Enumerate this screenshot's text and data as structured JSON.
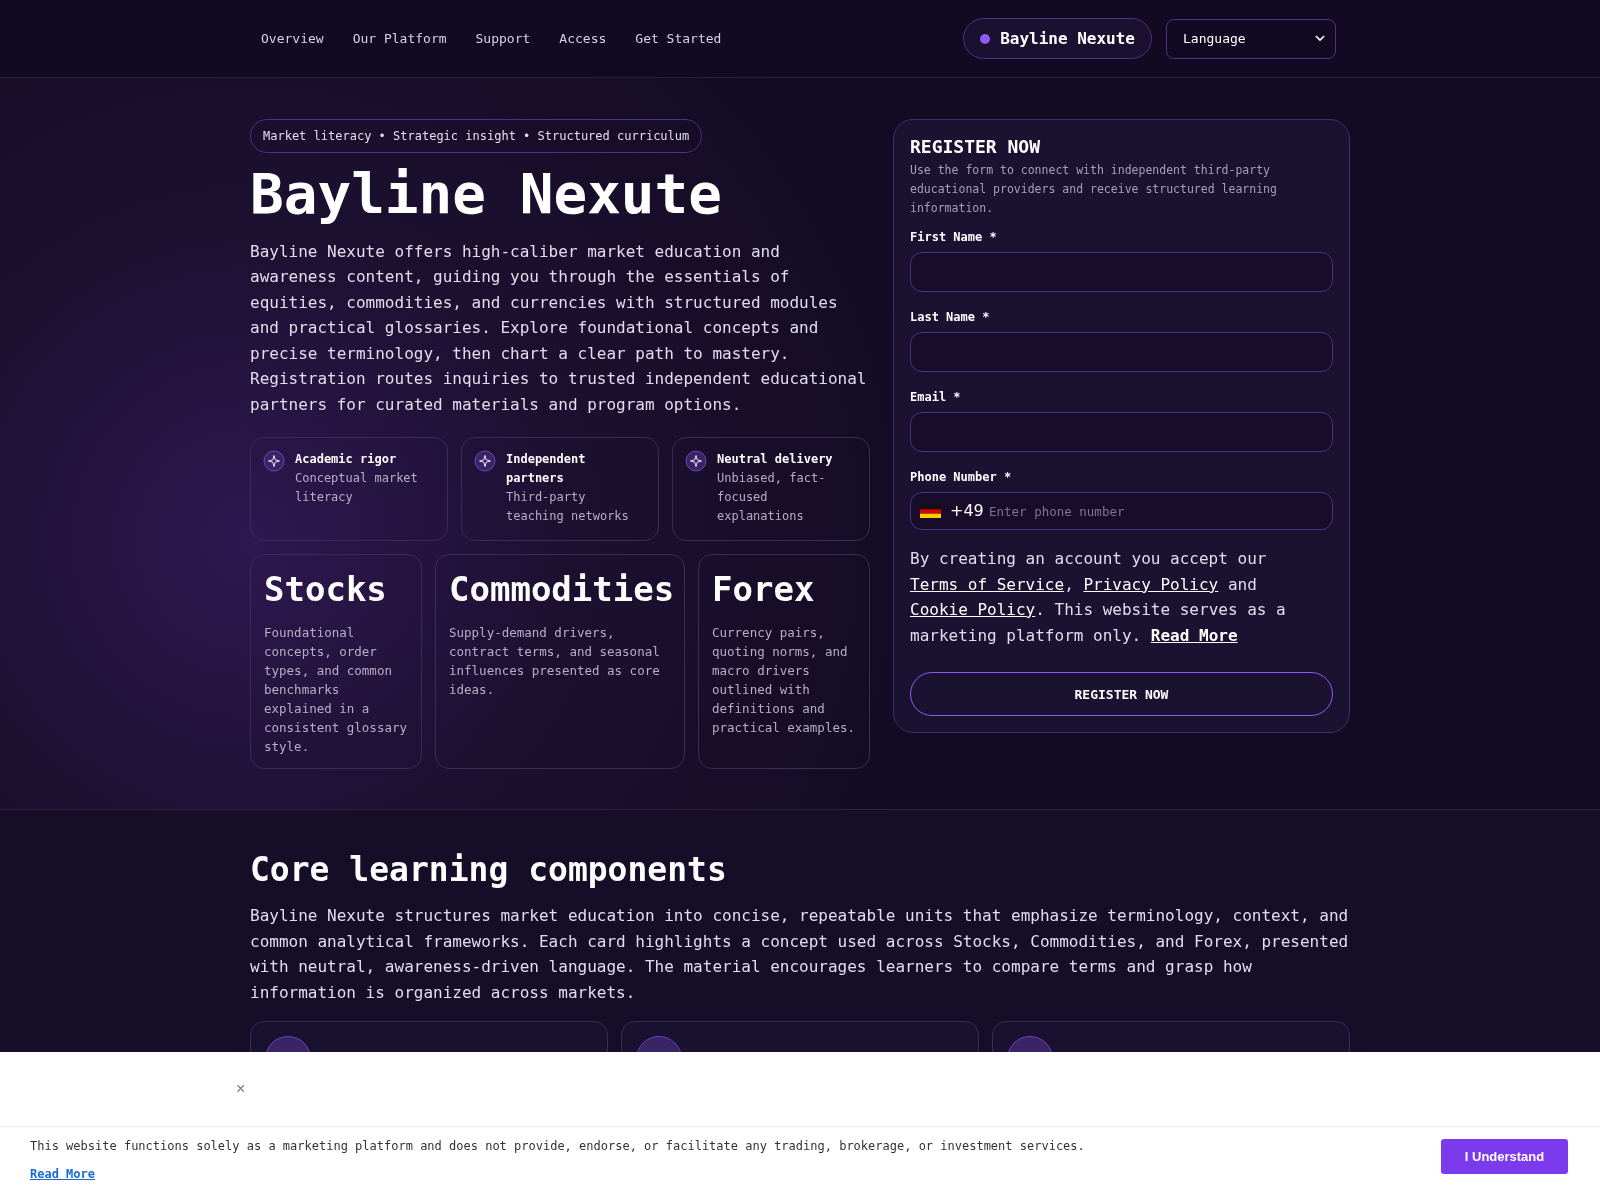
{
  "nav": {
    "links": [
      {
        "label": "Overview"
      },
      {
        "label": "Our Platform"
      },
      {
        "label": "Support"
      },
      {
        "label": "Access"
      },
      {
        "label": "Get Started"
      }
    ],
    "brand": "Bayline Nexute",
    "language_select": "Language"
  },
  "hero": {
    "tagline": "Market literacy • Strategic insight • Structured curriculum",
    "title": "Bayline Nexute",
    "description": "Bayline Nexute offers high-caliber market education and awareness content, guiding you through the essentials of equities, commodities, and currencies with structured modules and practical glossaries. Explore foundational concepts and precise terminology, then chart a clear path to mastery. Registration routes inquiries to trusted independent educational partners for curated materials and program options.",
    "features": [
      {
        "title": "Academic rigor",
        "text": "Conceptual market literacy"
      },
      {
        "title": "Independent partners",
        "text": "Third-party teaching networks"
      },
      {
        "title": "Neutral delivery",
        "text": "Unbiased, fact-focused explanations"
      }
    ],
    "markets": [
      {
        "title": "Stocks",
        "text": "Foundational concepts, order types, and common benchmarks explained in a consistent glossary style."
      },
      {
        "title": "Commodities",
        "text": "Supply-demand drivers, contract terms, and seasonal influences presented as core ideas."
      },
      {
        "title": "Forex",
        "text": "Currency pairs, quoting norms, and macro drivers outlined with definitions and practical examples."
      }
    ]
  },
  "register_form": {
    "title": "REGISTER NOW",
    "intro": "Use the form to connect with independent third-party educational providers and receive structured learning information.",
    "fields": [
      {
        "label": "First Name *",
        "kind": "text"
      },
      {
        "label": "Last Name *",
        "kind": "text"
      },
      {
        "label": "Email *",
        "kind": "text"
      },
      {
        "label": "Phone Number *",
        "kind": "phone",
        "prefix": "+49",
        "placeholder": "Enter phone number"
      }
    ],
    "consent": {
      "before": "By creating an account you accept our",
      "terms": "Terms of Service",
      "comma": ",",
      "privacy": "Privacy Policy",
      "and": "and",
      "cookie": "Cookie Policy",
      "after": ". This website serves as a marketing platform only.",
      "read_more": "Read More"
    },
    "submit": "REGISTER NOW"
  },
  "core": {
    "title": "Core learning components",
    "description": "Bayline Nexute structures market education into concise, repeatable units that emphasize terminology, context, and common analytical frameworks. Each card highlights a concept used across Stocks, Commodities, and Forex, presented with neutral, awareness-driven language. The material encourages learners to compare terms and grasp how information is organized across markets."
  },
  "cookie_banner": {
    "close": "×",
    "text": "This website functions solely as a marketing platform and does not provide, endorse, or facilitate any trading, brokerage, or investment services.",
    "read_more": "Read More",
    "button": "I Understand"
  }
}
